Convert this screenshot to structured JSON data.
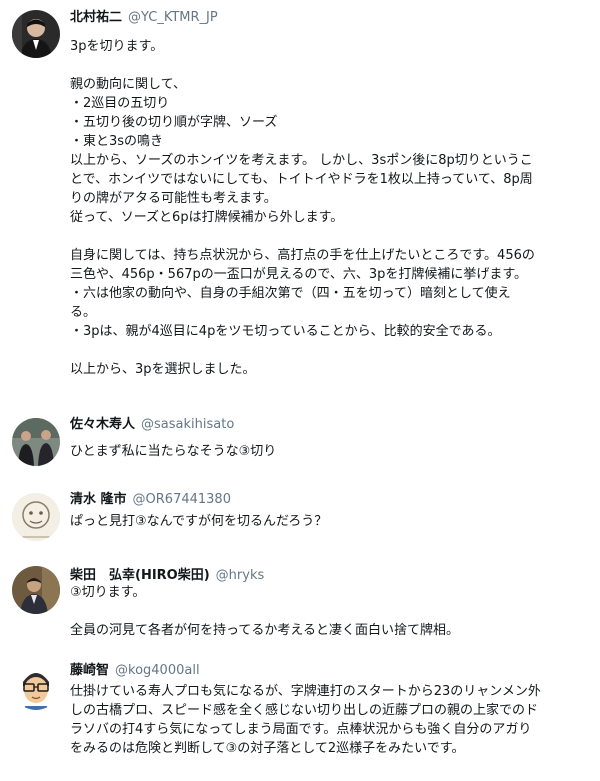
{
  "comments": [
    {
      "name": "北村祐二",
      "handle": "@YC_KTMR_JP",
      "lines": [
        "3pを切ります。",
        "",
        "親の動向に関して、",
        "・2巡目の五切り",
        "・五切り後の切り順が字牌、ソーズ",
        "・東と3sの鳴き",
        "以上から、ソーズのホンイツを考えます。 しかし、3sポン後に8p切りというこ",
        "とで、ホンイツではないにしても、トイトイやドラを1枚以上持っていて、8p周",
        "りの牌がアタる可能性も考えます。",
        "従って、ソーズと6pは打牌候補から外します。",
        "",
        "自身に関しては、持ち点状況から、高打点の手を仕上げたいところです。456の",
        "三色や、456p・567pの一盃口が見えるので、六、3pを打牌候補に挙げます。",
        "・六は他家の動向や、自身の手組次第で（四・五を切って）暗刻として使え",
        "る。",
        "・3pは、親が4巡目に4pをツモ切っていることから、比較的安全である。",
        "",
        "以上から、3pを選択しました。"
      ]
    },
    {
      "name": "佐々木寿人",
      "handle": "@sasakihisato",
      "lines": [
        "ひとまず私に当たらなそうな③切り"
      ]
    },
    {
      "name": "清水 隆市",
      "handle": "@OR67441380",
      "lines": [
        "ぱっと見打③なんですが何を切るんだろう？"
      ]
    },
    {
      "name": "柴田　弘幸(HIRO柴田)",
      "handle": "@hryks",
      "lines": [
        "③切ります。",
        "",
        "全員の河見て各者が何を持ってるか考えると凄く面白い捨て牌相。"
      ]
    },
    {
      "name": "藤崎智",
      "handle": "@kog4000all",
      "lines": [
        "仕掛けている寿人プロも気になるが、字牌連打のスタートから23のリャンメン外",
        "しの古橋プロ、スピード感を全く感じない切り出しの近藤プロの親の上家でのド",
        "ラソバの打4すら気になってしまう局面です。点棒状況からも強く自分のアガり",
        "をみるのは危険と判断して③の対子落として2巡様子をみたいです。"
      ]
    }
  ],
  "colors": {
    "name": "#14171a",
    "handle": "#657786",
    "text": "#14171a"
  }
}
